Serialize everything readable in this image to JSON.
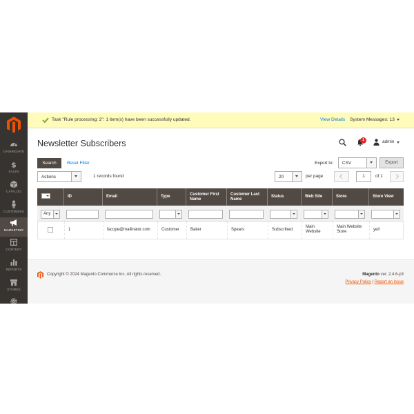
{
  "colors": {
    "sidebar": "#373330",
    "accent": "#eb5202",
    "link": "#007bdb",
    "header": "#514943",
    "message_bg": "#fffbbb",
    "success": "#79a22e"
  },
  "sidebar": {
    "items": [
      {
        "label": "DASHBOARD",
        "icon": "dashboard-icon"
      },
      {
        "label": "SALES",
        "icon": "dollar-icon"
      },
      {
        "label": "CATALOG",
        "icon": "cube-icon"
      },
      {
        "label": "CUSTOMERS",
        "icon": "person-icon"
      },
      {
        "label": "MARKETING",
        "icon": "megaphone-icon"
      },
      {
        "label": "CONTENT",
        "icon": "layout-icon"
      },
      {
        "label": "REPORTS",
        "icon": "bar-chart-icon"
      },
      {
        "label": "STORES",
        "icon": "store-icon"
      },
      {
        "label": "",
        "icon": "gear-icon"
      }
    ]
  },
  "message": {
    "text": "Task \"Rule processing: 2\": 1 item(s) have been successfully updated.",
    "view_details": "View Details",
    "system_messages": "System Messages: 13"
  },
  "header": {
    "title": "Newsletter Subscribers",
    "notification_count": "1",
    "user": "admin"
  },
  "toolbar": {
    "search_label": "Search",
    "reset_label": "Reset Filter",
    "export_label": "Export to:",
    "export_value": "CSV",
    "export_button": "Export",
    "actions_value": "Actions",
    "records_found": "1 records found",
    "per_page_value": "20",
    "per_page_label": "per page",
    "current_page": "1",
    "total_pages": "of 1"
  },
  "grid": {
    "columns": [
      "ID",
      "Email",
      "Type",
      "Customer First Name",
      "Customer Last Name",
      "Status",
      "Web Site",
      "Store",
      "Store View"
    ],
    "filter_any": "Any",
    "rows": [
      {
        "id": "1",
        "email": "facope@mailinator.com",
        "type": "Customer",
        "first_name": "Baker",
        "last_name": "Spears",
        "status": "Subscribed",
        "website": "Main Website",
        "store": "Main Website Store",
        "store_view": "yell"
      }
    ]
  },
  "footer": {
    "copyright": "Copyright © 2024 Magento Commerce Inc. All rights reserved.",
    "product": "Magento",
    "version": " ver. 2.4.6-p3",
    "privacy": "Privacy Policy",
    "separator": " | ",
    "report": "Report an Issue"
  }
}
